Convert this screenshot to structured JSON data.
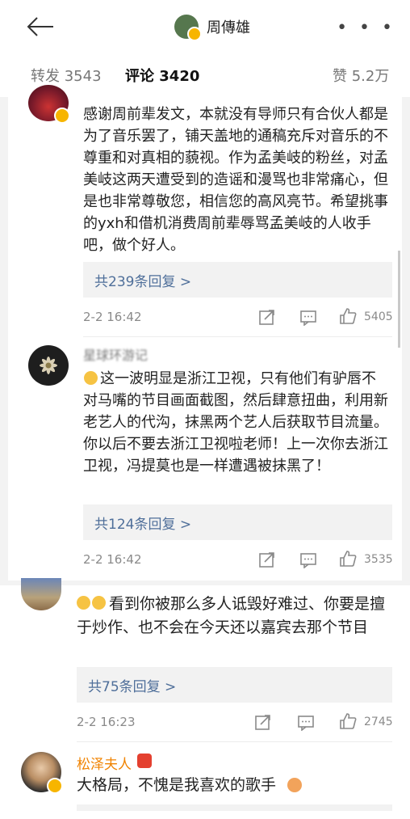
{
  "header": {
    "title": "周傳雄",
    "more_label": "• • •"
  },
  "tabs": [
    {
      "label": "转发 3543"
    },
    {
      "label": "评论 3420"
    },
    {
      "label": "赞 5.2万"
    }
  ],
  "comments": [
    {
      "text": "感谢周前辈发文，本就没有导师只有合伙人都是为了音乐罢了，铺天盖地的通稿充斥对音乐的不尊重和对真相的藐视。作为孟美岐的粉丝，对孟美岐这两天遭受到的造谣和漫骂也非常痛心，但是也非常尊敬您，相信您的高风亮节。希望挑事的yxh和借机消费周前辈辱骂孟美岐的人收手吧，做个好人。",
      "reply": "共239条回复 >",
      "time": "2-2 16:42",
      "likes": "5405"
    },
    {
      "name": "星球环游记",
      "text": "这一波明显是浙江卫视，只有他们有驴唇不对马嘴的节目画面截图，然后肆意扭曲，利用新老艺人的代沟，抹黑两个艺人后获取节目流量。你以后不要去浙江卫视啦老师！上一次你去浙江卫视，冯提莫也是一样遭遇被抹黑了！",
      "reply": "共124条回复 >",
      "time": "2-2 16:42",
      "likes": "3535"
    },
    {
      "text": "看到你被那么多人诋毁好难过、你要是擅于炒作、也不会在今天还以嘉宾去那个节目",
      "reply": "共75条回复 >",
      "time": "2-2 16:23",
      "likes": "2745"
    },
    {
      "name": "松泽夫人",
      "text": "大格局，不愧是我喜欢的歌手"
    }
  ]
}
